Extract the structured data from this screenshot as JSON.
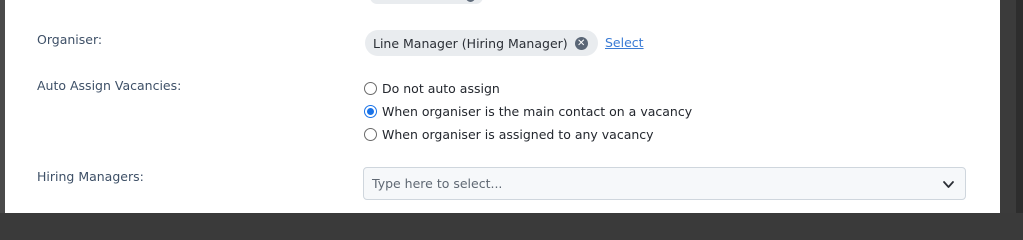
{
  "form": {
    "organiser": {
      "label": "Organiser:",
      "chip_label": "Line Manager (Hiring Manager)",
      "remove_icon": "close-icon",
      "select_link": "Select"
    },
    "auto_assign": {
      "label": "Auto Assign Vacancies:",
      "options": [
        {
          "label": "Do not auto assign",
          "checked": false
        },
        {
          "label": "When organiser is the main contact on a vacancy",
          "checked": true
        },
        {
          "label": "When organiser is assigned to any vacancy",
          "checked": false
        }
      ]
    },
    "hiring_managers": {
      "label": "Hiring Managers:",
      "placeholder": "Type here to select...",
      "dropdown_icon": "chevron-down-icon"
    }
  },
  "colors": {
    "label": "#3e5067",
    "link": "#3a7bd5",
    "radio_checked": "#1a73e8",
    "chip_bg": "#e9ecef"
  }
}
